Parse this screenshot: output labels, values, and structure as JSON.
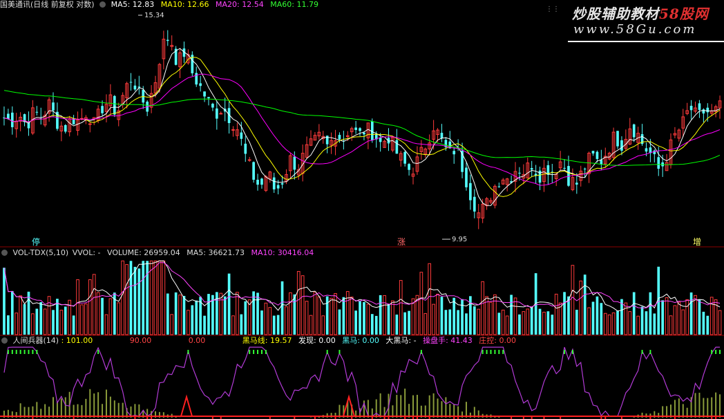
{
  "main_header": {
    "title": "国美通讯(日线 前复权 对数)",
    "ma5": "MA5: 12.83",
    "ma10": "MA10: 12.66",
    "ma20": "MA20: 12.54",
    "ma60": "MA60: 11.79",
    "high_label": "15.34",
    "low_label": "9.95",
    "tags": [
      "停",
      "涨",
      "增"
    ]
  },
  "vol_header": {
    "name": "VOL-TDX(5,10)",
    "vvol": "VVOL: -",
    "volume": "VOLUME: 26959.04",
    "ma5": "MA5: 36621.73",
    "ma10": "MA10: 30416.04"
  },
  "ind_header": {
    "name": "人间兵器(14)",
    "v1": ": 101.00",
    "v2": "90.00",
    "v3": "0.00",
    "heima": "黑马线: 19.57",
    "faxian": "发现: 0.00",
    "heima2": "黑马: 0.00",
    "daheima": "大黑马: -",
    "caopan": "操盘手: 41.43",
    "zhuangkong": "庄控: 0.00"
  },
  "watermark": {
    "line1_a": "炒股辅助教材",
    "line1_b": "58股网",
    "line2": "www.58Gu.com"
  },
  "colors": {
    "up": "#ff3b3b",
    "down": "#54ffff",
    "ma5": "#ffffff",
    "ma10": "#ffff00",
    "ma20": "#ff00ff",
    "ma60": "#00ff00",
    "ind_purple": "#b23bd6",
    "ind_olive": "#8a9b3a"
  },
  "chart_data": [
    {
      "type": "candlestick",
      "title": "国美通讯(日线 前复权 对数)",
      "ylim": [
        9.5,
        16.0
      ],
      "y_scale": "log",
      "annotations": [
        {
          "label": "15.34",
          "kind": "high"
        },
        {
          "label": "9.95",
          "kind": "low"
        }
      ],
      "series": [
        {
          "name": "MA5",
          "last": 12.83
        },
        {
          "name": "MA10",
          "last": 12.66
        },
        {
          "name": "MA20",
          "last": 12.54
        },
        {
          "name": "MA60",
          "last": 11.79
        }
      ],
      "close_path": [
        12.6,
        12.5,
        12.7,
        12.4,
        12.8,
        12.6,
        13.0,
        12.5,
        12.3,
        12.6,
        12.5,
        12.8,
        12.4,
        12.9,
        13.1,
        12.7,
        13.4,
        13.8,
        13.2,
        12.9,
        13.6,
        14.8,
        15.1,
        14.2,
        14.6,
        13.9,
        13.5,
        13.1,
        12.7,
        12.9,
        12.6,
        12.3,
        11.6,
        11.1,
        10.8,
        11.2,
        10.7,
        11.0,
        11.5,
        11.3,
        11.7,
        11.9,
        12.1,
        11.8,
        12.2,
        12.0,
        12.4,
        12.1,
        12.3,
        12.2,
        11.9,
        12.1,
        11.7,
        11.4,
        11.2,
        11.5,
        11.9,
        12.4,
        12.0,
        11.6,
        11.8,
        11.2,
        10.6,
        10.2,
        10.4,
        10.8,
        11.1,
        11.0,
        11.3,
        11.2,
        11.4,
        11.1,
        11.3,
        11.2,
        11.5,
        11.0,
        10.9,
        11.3,
        11.6,
        11.4,
        11.7,
        12.1,
        11.9,
        12.4,
        12.2,
        11.8,
        11.6,
        11.2,
        11.6,
        12.1,
        12.4,
        12.9,
        12.6,
        12.8,
        12.7,
        12.9
      ]
    },
    {
      "type": "bar",
      "title": "VOL-TDX(5,10)",
      "series": [
        {
          "name": "VOLUME",
          "last": 26959.04
        },
        {
          "name": "MA5",
          "last": 36621.73
        },
        {
          "name": "MA10",
          "last": 30416.04
        }
      ]
    },
    {
      "type": "line",
      "title": "人间兵器(14)",
      "ylim": [
        0,
        101
      ],
      "series": [
        {
          "name": "黑马线",
          "last": 19.57
        },
        {
          "name": "操盘手",
          "last": 41.43
        },
        {
          "name": "庄控",
          "last": 0.0
        }
      ]
    }
  ]
}
